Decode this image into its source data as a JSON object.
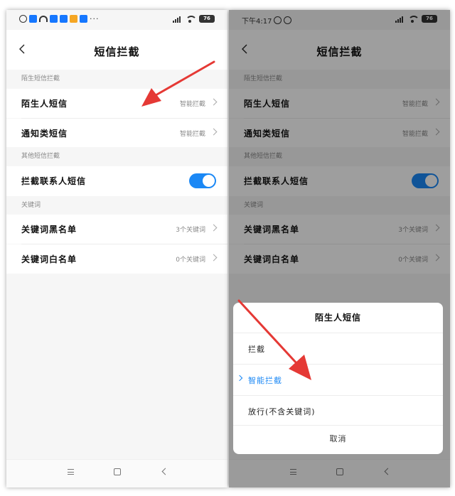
{
  "status": {
    "battery": "76",
    "right_time": "下午4:17",
    "left_dots": "···"
  },
  "header": {
    "title": "短信拦截"
  },
  "sections": {
    "stranger": {
      "header": "陌生短信拦截",
      "rows": [
        {
          "label": "陌生人短信",
          "value": "智能拦截"
        },
        {
          "label": "通知类短信",
          "value": "智能拦截"
        }
      ]
    },
    "other": {
      "header": "其他短信拦截",
      "row_label": "拦截联系人短信",
      "toggle_on": true
    },
    "keywords": {
      "header": "关键词",
      "rows": [
        {
          "label": "关键词黑名单",
          "value": "3个关键词"
        },
        {
          "label": "关键词白名单",
          "value": "0个关键词"
        }
      ]
    }
  },
  "dialog": {
    "title": "陌生人短信",
    "options": [
      {
        "label": "拦截",
        "selected": false
      },
      {
        "label": "智能拦截",
        "selected": true
      },
      {
        "label": "放行(不含关键词)",
        "selected": false
      }
    ],
    "cancel": "取消"
  },
  "colors": {
    "accent": "#1b88f5",
    "annotation_arrow": "#e53935"
  }
}
